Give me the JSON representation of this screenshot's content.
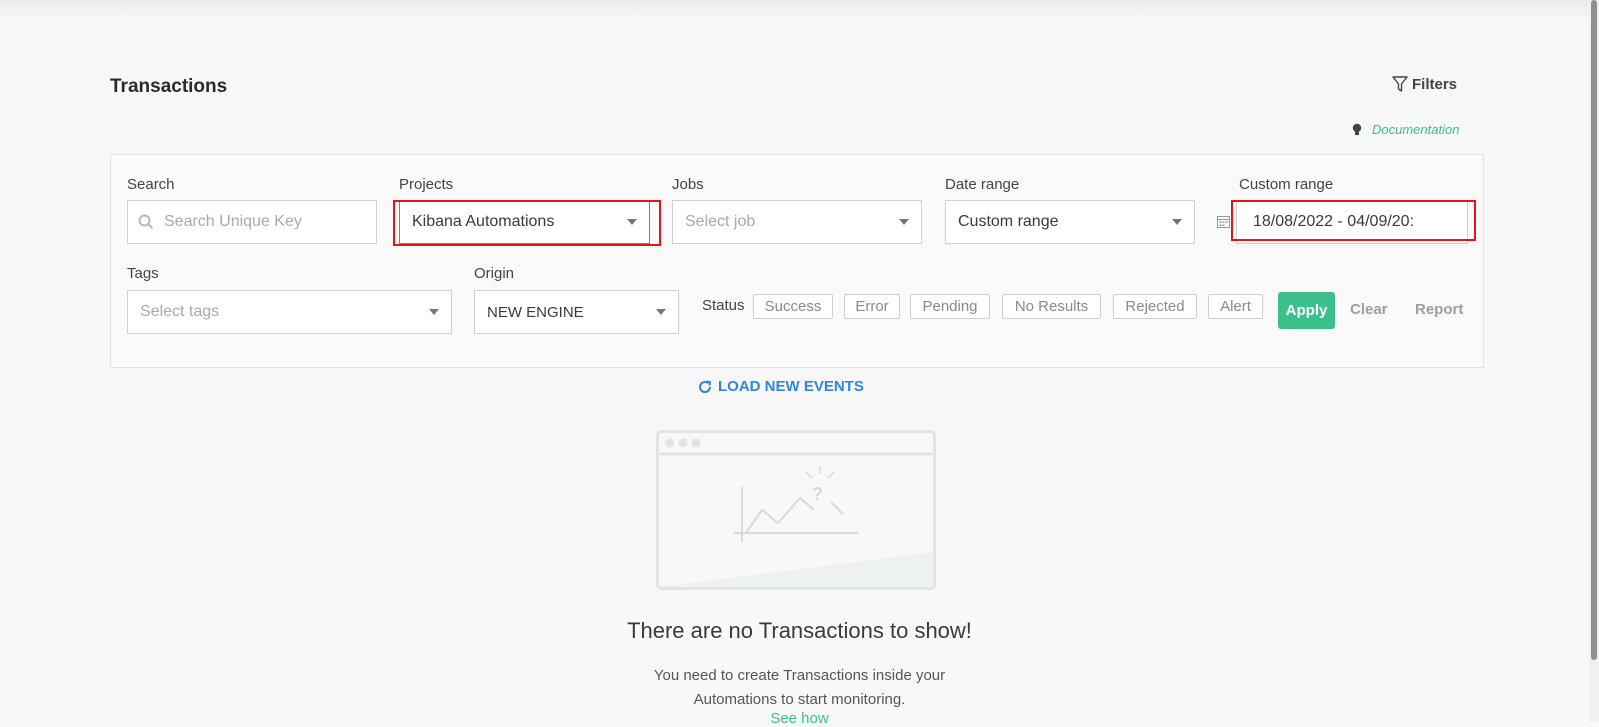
{
  "header": {
    "title": "Transactions",
    "filters_label": "Filters",
    "documentation_label": "Documentation"
  },
  "filters": {
    "search": {
      "label": "Search",
      "placeholder": "Search Unique Key"
    },
    "projects": {
      "label": "Projects",
      "value": "Kibana Automations"
    },
    "jobs": {
      "label": "Jobs",
      "placeholder": "Select job"
    },
    "date_range": {
      "label": "Date range",
      "value": "Custom range"
    },
    "custom_range": {
      "label": "Custom range",
      "value": "18/08/2022 - 04/09/20:"
    },
    "tags": {
      "label": "Tags",
      "placeholder": "Select tags"
    },
    "origin": {
      "label": "Origin",
      "value": "NEW ENGINE"
    },
    "status": {
      "label": "Status",
      "chips": [
        "Success",
        "Error",
        "Pending",
        "No Results",
        "Rejected",
        "Alert"
      ]
    },
    "actions": {
      "apply": "Apply",
      "clear": "Clear",
      "report": "Report"
    }
  },
  "load_new_events_label": "LOAD NEW EVENTS",
  "empty_state": {
    "title": "There are no Transactions to show!",
    "line1": "You need to create Transactions inside your",
    "line2": "Automations to start monitoring.",
    "link": "See how"
  },
  "colors": {
    "accent_green": "#3cc08b",
    "link_blue": "#2d86e6",
    "highlight_red": "#e4141c"
  }
}
